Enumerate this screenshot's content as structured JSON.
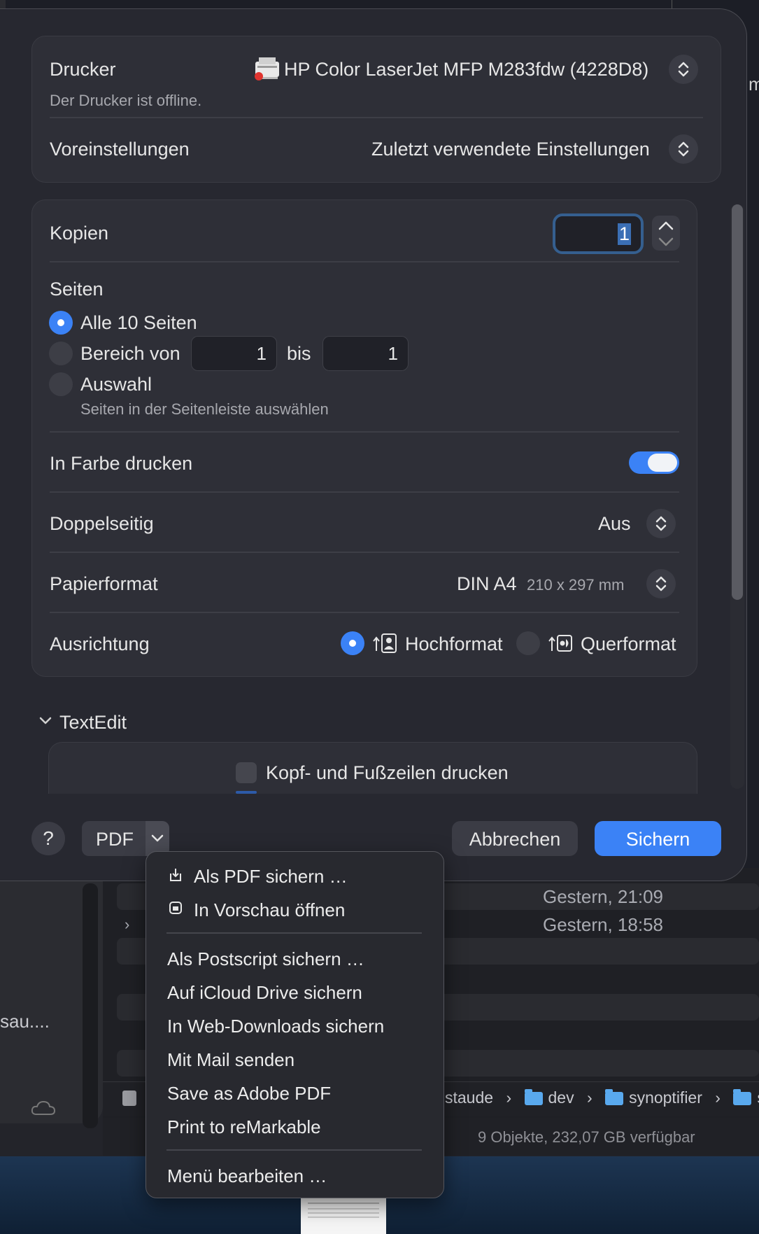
{
  "printer": {
    "label": "Drucker",
    "name": "HP Color LaserJet MFP M283fdw (4228D8)",
    "status": "Der Drucker ist offline."
  },
  "presets": {
    "label": "Voreinstellungen",
    "value": "Zuletzt verwendete Einstellungen"
  },
  "copies": {
    "label": "Kopien",
    "value": "1"
  },
  "pages": {
    "label": "Seiten",
    "all_label": "Alle 10 Seiten",
    "range_label": "Bereich von",
    "range_from": "1",
    "range_to_label": "bis",
    "range_to": "1",
    "selection_label": "Auswahl",
    "selection_hint": "Seiten in der Seitenleiste auswählen",
    "selected": "all"
  },
  "color": {
    "label": "In Farbe drucken",
    "enabled": true
  },
  "duplex": {
    "label": "Doppelseitig",
    "value": "Aus"
  },
  "paper": {
    "label": "Papierformat",
    "value": "DIN A4",
    "dimensions": "210 x 297 mm"
  },
  "orientation": {
    "label": "Ausrichtung",
    "portrait": "Hochformat",
    "landscape": "Querformat",
    "selected": "portrait"
  },
  "textedit": {
    "section_label": "TextEdit",
    "header_footer_label": "Kopf- und Fußzeilen drucken"
  },
  "footer": {
    "help_label": "?",
    "pdf_label": "PDF",
    "cancel_label": "Abbrechen",
    "save_label": "Sichern"
  },
  "pdf_menu": {
    "items": [
      "Als PDF sichern …",
      "In Vorschau öffnen",
      "Als Postscript sichern …",
      "Auf iCloud Drive sichern",
      "In Web-Downloads sichern",
      "Mit Mail senden",
      "Save as Adobe PDF",
      "Print to reMarkable",
      "Menü bearbeiten …"
    ]
  },
  "finder": {
    "rows": [
      {
        "date": "Gestern, 21:09"
      },
      {
        "date": "Gestern, 18:58"
      }
    ],
    "sidebar_fragment": "sau....",
    "path": [
      "staude",
      "dev",
      "synoptifier",
      "sy"
    ],
    "status": "9 Objekte, 232,07 GB verfügbar",
    "edge_fragment": "m"
  },
  "colors": {
    "accent": "#3b82f6",
    "dialog_bg": "#272830",
    "card_bg": "#2e2f37"
  }
}
